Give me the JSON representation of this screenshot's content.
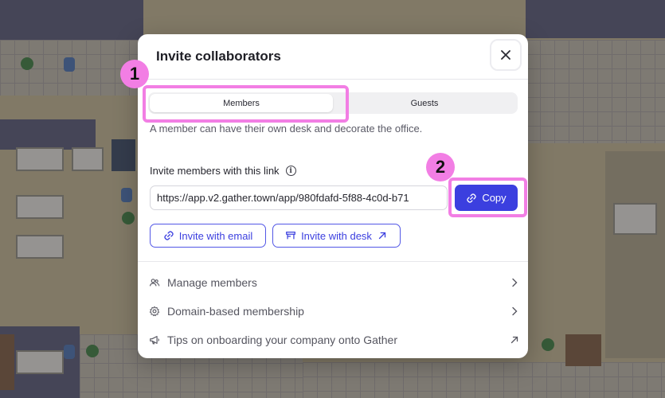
{
  "modal": {
    "title": "Invite collaborators",
    "tabs": [
      {
        "label": "Members",
        "active": true
      },
      {
        "label": "Guests",
        "active": false
      }
    ],
    "description": "A member can have their own desk and decorate the office.",
    "link_label": "Invite members with this link",
    "link_value": "https://app.v2.gather.town/app/980fdafd-5f88-4c0d-b71",
    "copy_label": "Copy",
    "invite_email_label": "Invite with email",
    "invite_desk_label": "Invite with desk",
    "menu": [
      {
        "label": "Manage members",
        "icon": "people-icon",
        "trailing": "chevron-right-icon"
      },
      {
        "label": "Domain-based membership",
        "icon": "gear-icon",
        "trailing": "chevron-right-icon"
      },
      {
        "label": "Tips on onboarding your company onto Gather",
        "icon": "megaphone-icon",
        "trailing": "external-arrow-icon"
      }
    ]
  },
  "annotations": {
    "step1": "1",
    "step2": "2",
    "highlight_color": "#f27ee4"
  },
  "colors": {
    "accent": "#3b3fdf",
    "text_primary": "#1f1f26",
    "text_secondary": "#5a5a66"
  }
}
